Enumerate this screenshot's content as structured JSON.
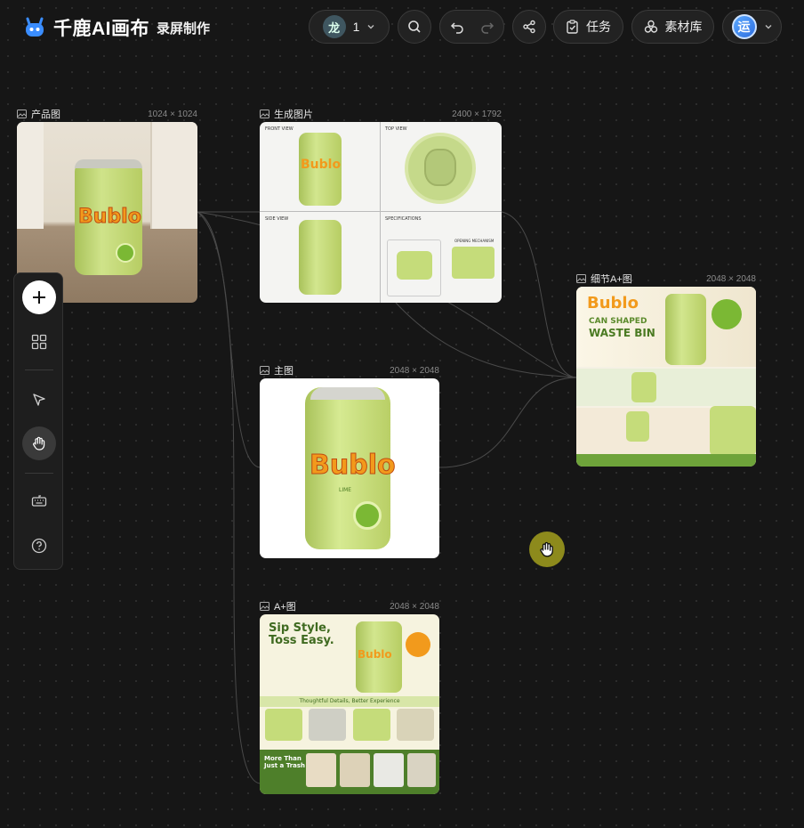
{
  "brand": {
    "name": "千鹿AI画布",
    "logo_icon": "deer-logo-icon"
  },
  "project": {
    "name": "录屏制作"
  },
  "toolbar": {
    "collaborator_initial": "龙",
    "collaborator_count": "1",
    "task_label": "任务",
    "assets_label": "素材库",
    "user_initial": "运"
  },
  "cards": {
    "product": {
      "title": "产品图",
      "size": "1024 × 1024"
    },
    "generated": {
      "title": "生成图片",
      "size": "2400 × 1792",
      "panels": [
        "FRONT VIEW",
        "TOP VIEW",
        "SIDE VIEW",
        "SPECIFICATIONS"
      ],
      "spec_sub": "OPENING MECHANISM"
    },
    "main": {
      "title": "主图",
      "size": "2048 × 2048"
    },
    "detail_aplus": {
      "title": "细节A+图",
      "size": "2048 × 2048",
      "headline1": "CAN SHAPED",
      "headline2": "WASTE BIN"
    },
    "aplus": {
      "title": "A+图",
      "size": "2048 × 2048",
      "headline1": "Sip Style,",
      "headline2": "Toss Easy.",
      "band": "Thoughtful Details, Better Experience",
      "footer1": "More Than",
      "footer2": "Just a Trash Bin"
    }
  },
  "product_brand": {
    "name": "Bublo",
    "flavor": "LIME"
  },
  "colors": {
    "background": "#161616",
    "can_green": "#c5dc7a",
    "brand_orange": "#f29a1c",
    "cursor_yellow": "#8d8a1c"
  }
}
